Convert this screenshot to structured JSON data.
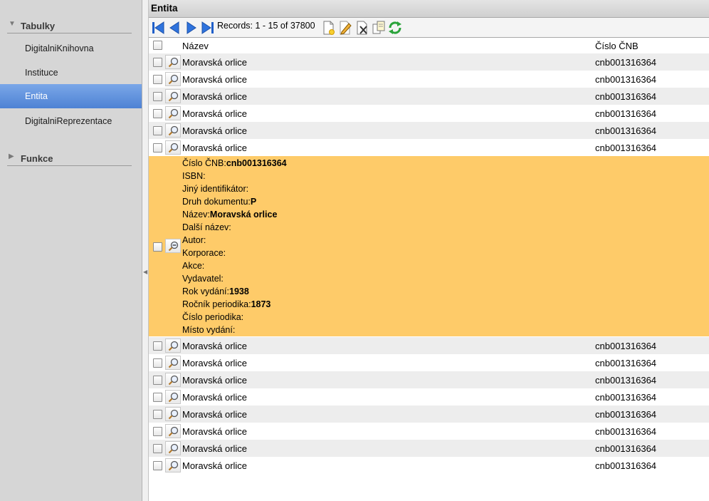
{
  "sidebar": {
    "sections": [
      {
        "label": "Tabulky",
        "expanded": true
      },
      {
        "label": "Funkce",
        "expanded": false
      }
    ],
    "items": [
      {
        "label": "DigitalniKnihovna",
        "active": false
      },
      {
        "label": "Instituce",
        "active": false
      },
      {
        "label": "Entita",
        "active": true
      },
      {
        "label": "DigitalniReprezentace",
        "active": false
      }
    ],
    "active_color": "#5a8edb"
  },
  "main": {
    "title": "Entita",
    "toolbar": {
      "records_text": "Records: 1 - 15 of 37800",
      "buttons": [
        "first-page-icon",
        "prev-page-icon",
        "next-page-icon",
        "last-page-icon",
        "new-record-icon",
        "edit-icon",
        "delete-icon",
        "copy-icon",
        "refresh-icon"
      ]
    },
    "grid": {
      "columns": [
        "Název",
        "Číslo ČNB"
      ],
      "rows_before": [
        {
          "nazev": "Moravská orlice",
          "cnb": "cnb001316364"
        },
        {
          "nazev": "Moravská orlice",
          "cnb": "cnb001316364"
        },
        {
          "nazev": "Moravská orlice",
          "cnb": "cnb001316364"
        },
        {
          "nazev": "Moravská orlice",
          "cnb": "cnb001316364"
        },
        {
          "nazev": "Moravská orlice",
          "cnb": "cnb001316364"
        },
        {
          "nazev": "Moravská orlice",
          "cnb": "cnb001316364"
        }
      ],
      "expanded_detail": {
        "highlight_color": "#fecb69",
        "fields": [
          {
            "label": "Číslo ČNB:",
            "value": "cnb001316364"
          },
          {
            "label": "ISBN:",
            "value": ""
          },
          {
            "label": "Jiný identifikátor:",
            "value": ""
          },
          {
            "label": "Druh dokumentu:",
            "value": "P"
          },
          {
            "label": "Název:",
            "value": "Moravská orlice"
          },
          {
            "label": "Další název:",
            "value": ""
          },
          {
            "label": "Autor:",
            "value": ""
          },
          {
            "label": "Korporace:",
            "value": ""
          },
          {
            "label": "Akce:",
            "value": ""
          },
          {
            "label": "Vydavatel:",
            "value": ""
          },
          {
            "label": "Rok vydání:",
            "value": "1938"
          },
          {
            "label": "Ročník periodika:",
            "value": "1873"
          },
          {
            "label": "Číslo periodika:",
            "value": ""
          },
          {
            "label": "Místo vydání:",
            "value": ""
          }
        ]
      },
      "rows_after": [
        {
          "nazev": "Moravská orlice",
          "cnb": "cnb001316364"
        },
        {
          "nazev": "Moravská orlice",
          "cnb": "cnb001316364"
        },
        {
          "nazev": "Moravská orlice",
          "cnb": "cnb001316364"
        },
        {
          "nazev": "Moravská orlice",
          "cnb": "cnb001316364"
        },
        {
          "nazev": "Moravská orlice",
          "cnb": "cnb001316364"
        },
        {
          "nazev": "Moravská orlice",
          "cnb": "cnb001316364"
        },
        {
          "nazev": "Moravská orlice",
          "cnb": "cnb001316364"
        },
        {
          "nazev": "Moravská orlice",
          "cnb": "cnb001316364"
        }
      ]
    }
  }
}
